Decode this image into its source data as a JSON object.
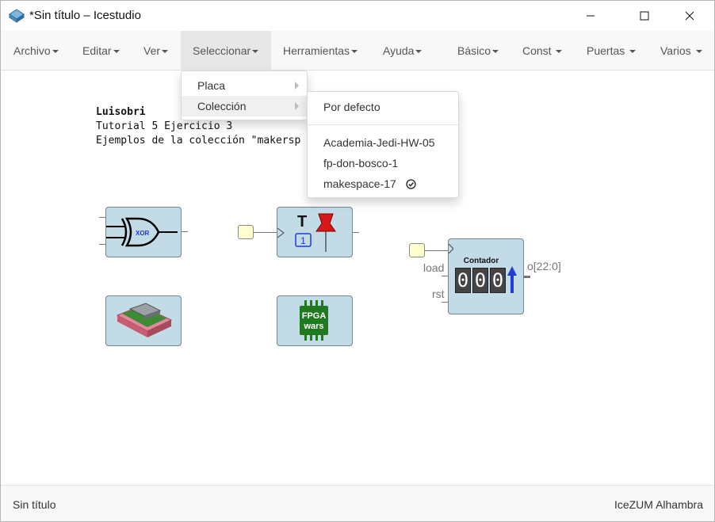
{
  "window": {
    "title": "*Sin título – Icestudio"
  },
  "menubar": {
    "items": [
      {
        "label": "Archivo"
      },
      {
        "label": "Editar"
      },
      {
        "label": "Ver"
      },
      {
        "label": "Seleccionar"
      },
      {
        "label": "Herramientas"
      },
      {
        "label": "Ayuda"
      },
      {
        "label": "Básico"
      },
      {
        "label": "Const"
      },
      {
        "label": "Puertas"
      },
      {
        "label": "Varios"
      }
    ]
  },
  "select_menu": {
    "items": [
      {
        "label": "Placa"
      },
      {
        "label": "Colección"
      }
    ]
  },
  "collection_menu": {
    "default": "Por defecto",
    "items": [
      {
        "label": "Academia-Jedi-HW-05",
        "selected": false
      },
      {
        "label": "fp-don-bosco-1",
        "selected": false
      },
      {
        "label": "makespace-17",
        "selected": true
      }
    ]
  },
  "canvas": {
    "note": {
      "line1": "Luisobri",
      "line2": "Tutorial 5 Ejercicio 3",
      "line3": "Ejemplos de la colección \"makersp"
    },
    "xor_label": "XOR",
    "tflipflop": {
      "letter": "T",
      "number": "1"
    },
    "fpga_text_1": "FPGA",
    "fpga_text_2": "wars",
    "counter": {
      "title": "Contador",
      "digits": [
        "0",
        "0",
        "0"
      ],
      "port_load": "load",
      "port_rst": "rst",
      "output": "o[22:0]"
    }
  },
  "statusbar": {
    "left": "Sin título",
    "right": "IceZUM Alhambra"
  },
  "colors": {
    "block_fill": "#c3dbe6",
    "pin_fill": "#ffffd0",
    "menu_active": "#e7e7e7"
  }
}
